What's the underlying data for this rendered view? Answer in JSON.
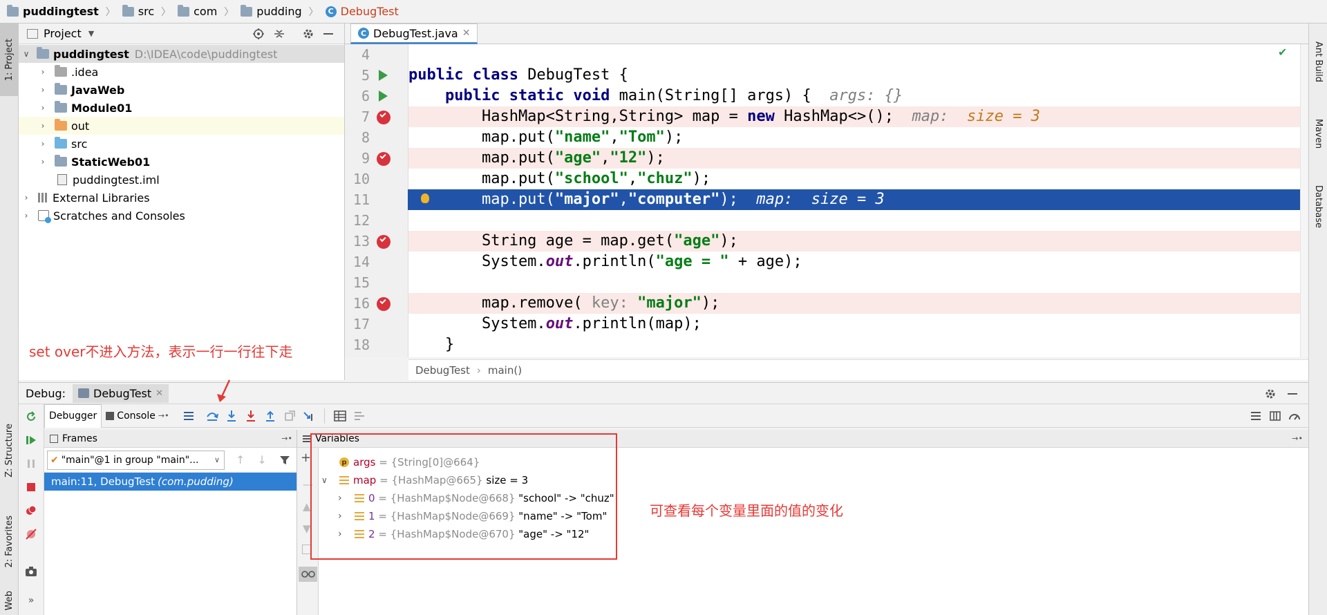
{
  "breadcrumb": {
    "items": [
      "puddingtest",
      "src",
      "com",
      "pudding",
      "DebugTest"
    ]
  },
  "left_strip": {
    "project_tab": "1: Project",
    "structure_tab": "Z: Structure",
    "favorites_tab": "2: Favorites",
    "web_tab": "Web"
  },
  "right_strip": {
    "ant_tab": "Ant Build",
    "maven_tab": "Maven",
    "database_tab": "Database"
  },
  "project": {
    "header": "Project",
    "root_name": "puddingtest",
    "root_path": "D:\\IDEA\\code\\puddingtest",
    "items": [
      ".idea",
      "JavaWeb",
      "Module01",
      "out",
      "src",
      "StaticWeb01",
      "puddingtest.iml"
    ],
    "external": "External Libraries",
    "scratches": "Scratches and Consoles"
  },
  "editor": {
    "tab": "DebugTest.java",
    "line_numbers": [
      "4",
      "5",
      "6",
      "7",
      "8",
      "9",
      "10",
      "11",
      "12",
      "13",
      "14",
      "15",
      "16",
      "17",
      "18"
    ],
    "footer_class": "DebugTest",
    "footer_method": "main()",
    "lines": {
      "l5_kw": "public class ",
      "l5_rest": "DebugTest {",
      "l6_kw": "    public static void ",
      "l6_rest": "main(String[] args) {  ",
      "l6_hint": "args: {}",
      "l7_a": "        HashMap<String,String> map = ",
      "l7_kw": "new",
      "l7_b": " HashMap<>();  ",
      "l7_hint": "map:  ",
      "l7_val": "size = 3",
      "l8_a": "        map.put(",
      "l8_s1": "\"name\"",
      "l8_c": ",",
      "l8_s2": "\"Tom\"",
      "l8_e": ");",
      "l9_a": "        map.put(",
      "l9_s1": "\"age\"",
      "l9_c": ",",
      "l9_s2": "\"12\"",
      "l9_e": ");",
      "l10_a": "        map.put(",
      "l10_s1": "\"school\"",
      "l10_c": ",",
      "l10_s2": "\"chuz\"",
      "l10_e": ");",
      "l11_a": "        map.put(",
      "l11_s1": "\"major\"",
      "l11_c": ",",
      "l11_s2": "\"computer\"",
      "l11_e": ");  ",
      "l11_hint": "map:  size = 3",
      "l13_a": "        String age = map.get(",
      "l13_s": "\"age\"",
      "l13_e": ");",
      "l14_a": "        System.",
      "l14_out": "out",
      "l14_b": ".println(",
      "l14_s": "\"age = \"",
      "l14_e": " + age);",
      "l16_a": "        map.remove( ",
      "l16_p": "key: ",
      "l16_s": "\"major\"",
      "l16_e": ");",
      "l17_a": "        System.",
      "l17_out": "out",
      "l17_b": ".println(map);",
      "l18": "    }"
    }
  },
  "debug": {
    "label": "Debug:",
    "config_tab": "DebugTest",
    "debugger_tab": "Debugger",
    "console_tab": "Console",
    "frames_header": "Frames",
    "thread": "\"main\"@1 in group \"main\"...",
    "frame": "main:11, DebugTest ",
    "frame_pkg": "(com.pudding)",
    "variables_header": "Variables",
    "variables": {
      "args_name": "args",
      "args_val": " = {String[0]@664}",
      "map_name": "map",
      "map_type": " = {HashMap@665}",
      "map_size": "  size = 3",
      "e0_name": "0",
      "e0_type": " = {HashMap$Node@668} ",
      "e0_val": "\"school\" -> \"chuz\"",
      "e1_name": "1",
      "e1_type": " = {HashMap$Node@669} ",
      "e1_val": "\"name\" -> \"Tom\"",
      "e2_name": "2",
      "e2_type": " = {HashMap$Node@670} ",
      "e2_val": "\"age\" -> \"12\""
    }
  },
  "annotations": {
    "step_over": "set over不进入方法，表示一行一行往下走",
    "variables_note": "可查看每个变量里面的值的变化"
  },
  "colors": {
    "breakpoint": "#d8323c",
    "current_line": "#2154a8",
    "annotation": "#e53935"
  }
}
